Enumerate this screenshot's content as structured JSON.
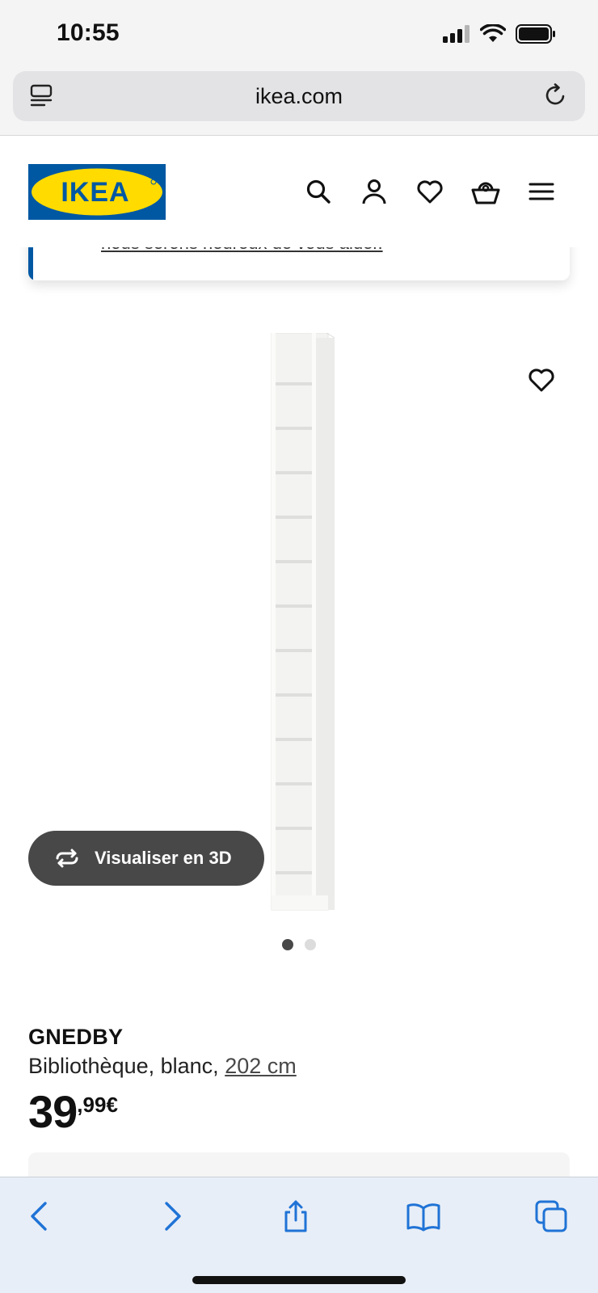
{
  "status_bar": {
    "time": "10:55"
  },
  "browser": {
    "url": "ikea.com"
  },
  "header": {
    "logo_text": "IKEA",
    "icons": [
      "search-icon",
      "account-icon",
      "wishlist-icon",
      "basket-icon",
      "menu-icon"
    ]
  },
  "notice": {
    "link_text": "nous serons heureux de vous aider."
  },
  "gallery": {
    "view_3d_label": "Visualiser en 3D",
    "image_count": 2,
    "active_image": 1
  },
  "product": {
    "name": "GNEDBY",
    "description": "Bibliothèque, blanc,",
    "size_link": "202 cm",
    "price_integer": "39",
    "price_decimal": ",99€"
  },
  "colors": {
    "ikea_blue": "#0058a3",
    "ikea_yellow": "#ffdb00",
    "button_dark": "#484848",
    "toolbar_tint": "#1f73d6"
  }
}
